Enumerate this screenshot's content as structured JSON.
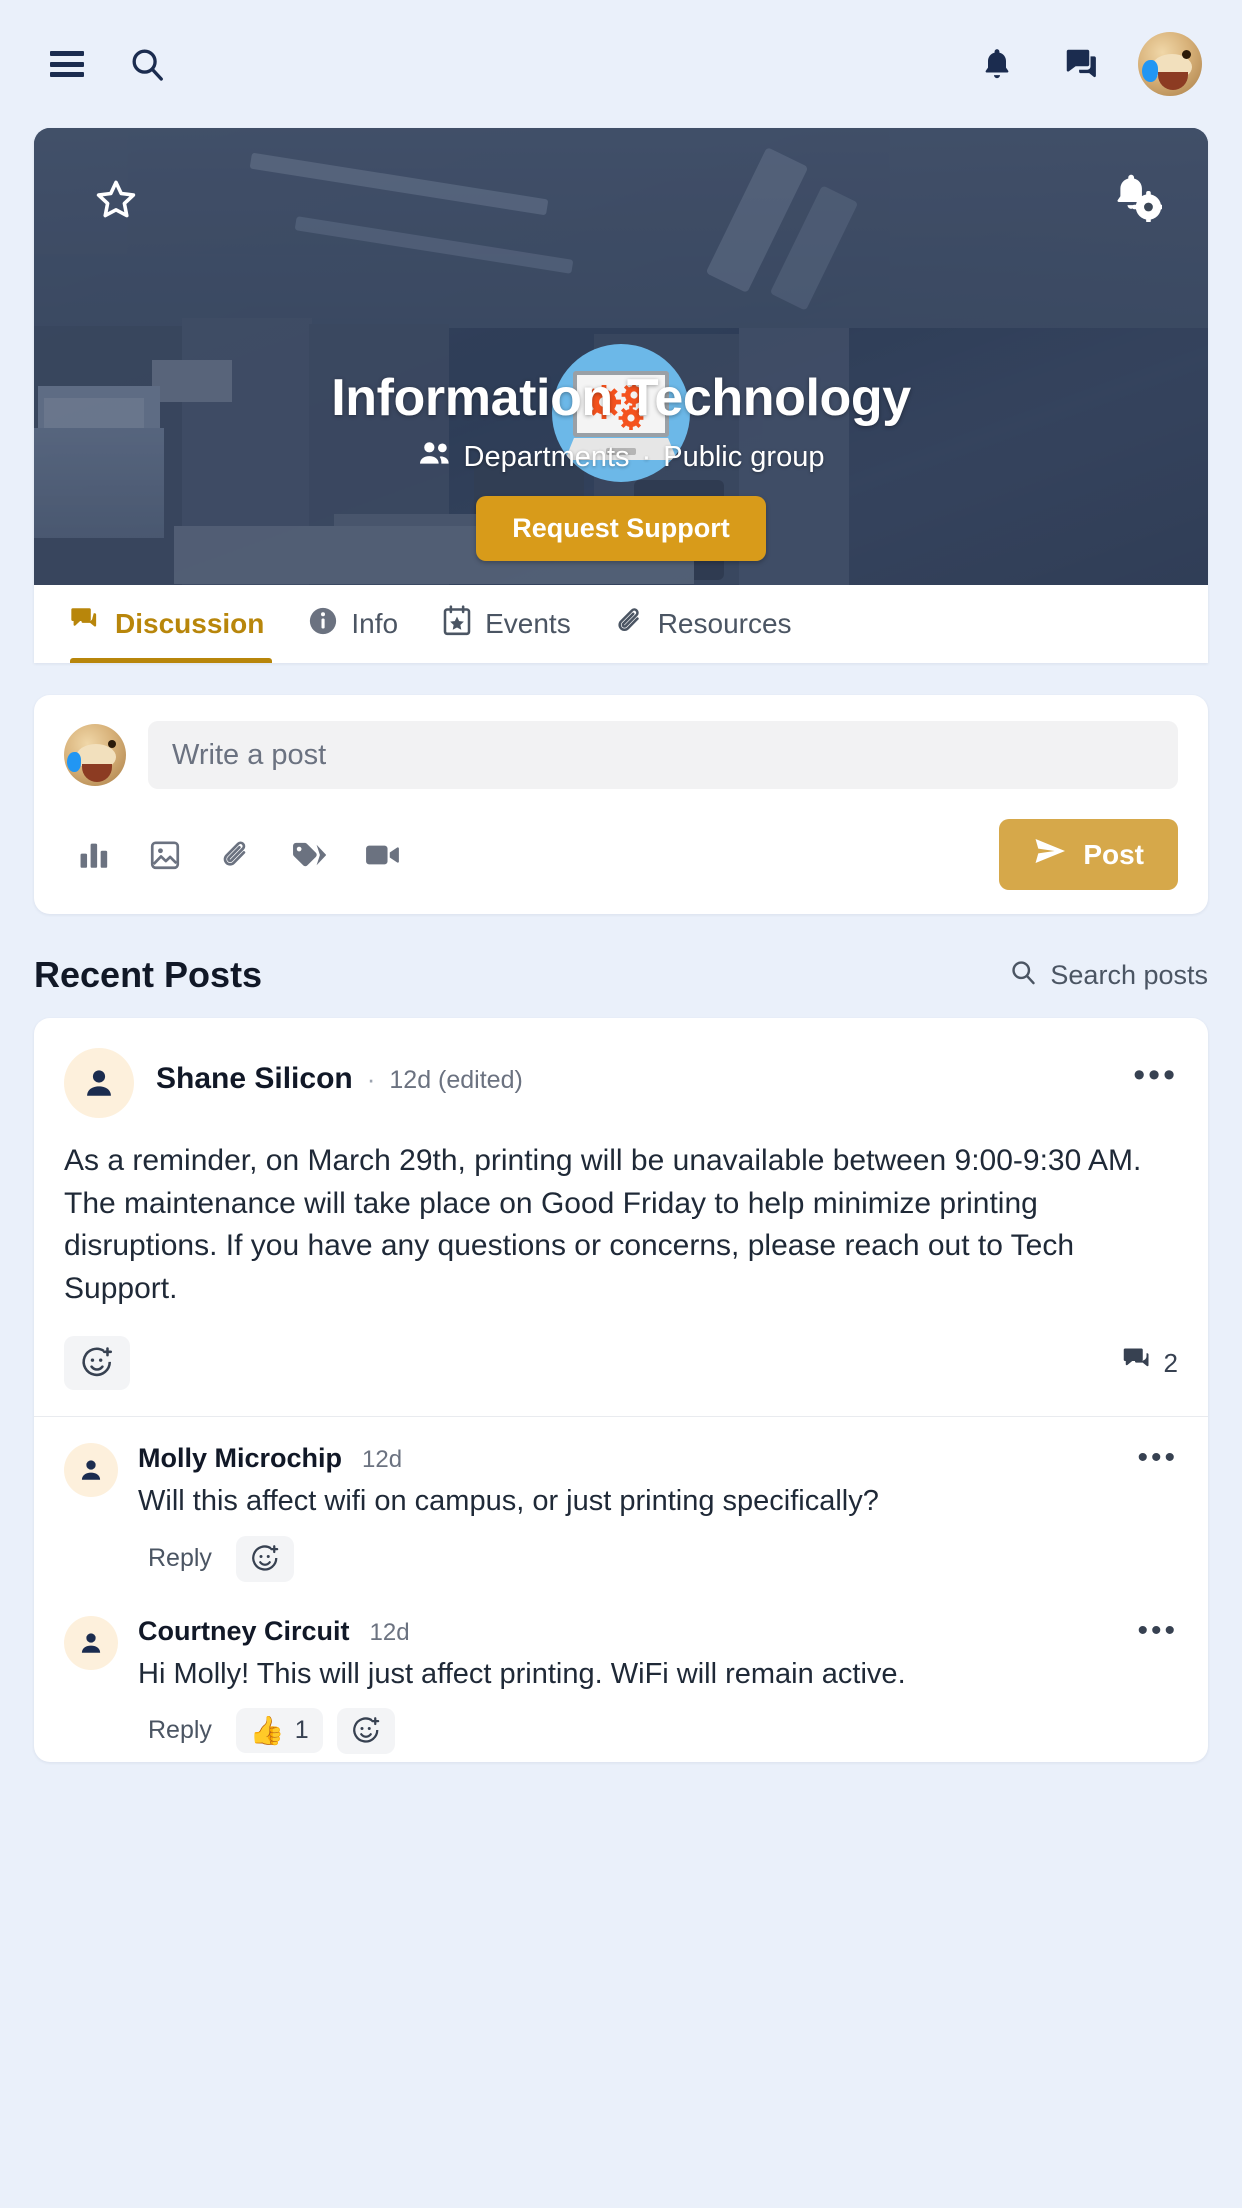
{
  "topbar": {
    "menu_icon": "hamburger-menu-icon",
    "search_icon": "search-icon",
    "notifications_icon": "bell-icon",
    "messages_icon": "chat-icon",
    "avatar_icon": "user-avatar"
  },
  "hero": {
    "favorite_icon": "star-outline-icon",
    "notification_settings_icon": "bell-settings-icon",
    "logo_icon": "laptop-gears-logo",
    "title": "Information Technology",
    "group_type": "Departments",
    "separator": "·",
    "visibility": "Public group",
    "people_icon": "people-icon",
    "cta_label": "Request Support"
  },
  "tabs": [
    {
      "label": "Discussion",
      "icon": "discussion-icon",
      "active": true
    },
    {
      "label": "Info",
      "icon": "info-icon",
      "active": false
    },
    {
      "label": "Events",
      "icon": "calendar-star-icon",
      "active": false
    },
    {
      "label": "Resources",
      "icon": "paperclip-icon",
      "active": false
    }
  ],
  "composer": {
    "placeholder": "Write a post",
    "value": "",
    "tools": [
      {
        "name": "poll-icon"
      },
      {
        "name": "image-icon"
      },
      {
        "name": "attachment-icon"
      },
      {
        "name": "tag-icon"
      },
      {
        "name": "video-icon"
      }
    ],
    "post_label": "Post",
    "post_icon": "send-icon"
  },
  "recent_posts": {
    "title": "Recent Posts",
    "search_label": "Search posts",
    "search_icon": "search-icon"
  },
  "post": {
    "author": "Shane Silicon",
    "separator": "·",
    "time": "12d (edited)",
    "more_icon": "more-options-icon",
    "body": "As a reminder, on March 29th, printing will be unavailable between 9:00-9:30 AM. The maintenance will take place on Good Friday to help minimize printing disruptions. If you have any questions or concerns, please reach out to Tech Support.",
    "add_reaction_icon": "add-reaction-icon",
    "comment_icon": "comment-icon",
    "comment_count": "2",
    "comments": [
      {
        "author": "Molly Microchip",
        "time": "12d",
        "text": "Will this affect wifi on campus, or just printing specifically?",
        "reply_label": "Reply",
        "more_icon": "more-options-icon",
        "add_reaction_icon": "add-reaction-icon",
        "reactions": []
      },
      {
        "author": "Courtney Circuit",
        "time": "12d",
        "text": "Hi Molly! This will just affect printing. WiFi will remain active.",
        "reply_label": "Reply",
        "more_icon": "more-options-icon",
        "add_reaction_icon": "add-reaction-icon",
        "reactions": [
          {
            "emoji": "👍",
            "count": "1"
          }
        ]
      }
    ]
  },
  "colors": {
    "accent_gold": "#d89b1a",
    "post_button": "#d6a84a",
    "page_bg": "#eaf0fa",
    "tab_active": "#b8860b",
    "navy": "#1b2c4f"
  }
}
